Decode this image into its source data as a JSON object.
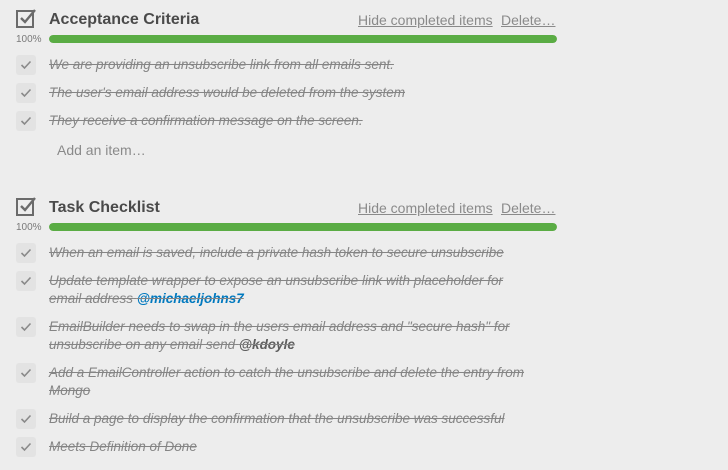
{
  "checklists": [
    {
      "title": "Acceptance Criteria",
      "hide_completed_label": "Hide completed items",
      "delete_label": "Delete…",
      "progress_label": "100%",
      "progress": 1.0,
      "progress_color": "#5aac44",
      "items": [
        {
          "text": "We are providing an unsubscribe link from all emails sent.",
          "checked": true
        },
        {
          "text": "The user's email address would be deleted from the system",
          "checked": true
        },
        {
          "text": "They receive a confirmation message on the screen.",
          "checked": true
        }
      ],
      "add_item_label": "Add an item…"
    },
    {
      "title": "Task Checklist",
      "hide_completed_label": "Hide completed items",
      "delete_label": "Delete…",
      "progress_label": "100%",
      "progress": 1.0,
      "progress_color": "#5aac44",
      "items": [
        {
          "text": "When an email is saved, include a private hash token to secure unsubscribe",
          "checked": true
        },
        {
          "text": "Update template wrapper to expose an unsubscribe link with placeholder for email address",
          "mention": "@michaeljohns7",
          "mention_linked": true,
          "checked": true
        },
        {
          "text": "EmailBuilder needs to swap in the users email address and \"secure hash\" for unsubscribe on any email send",
          "mention": "@kdoyle",
          "mention_linked": false,
          "checked": true
        },
        {
          "text": "Add a EmailController action to catch the unsubscribe and delete the entry from Mongo",
          "checked": true
        },
        {
          "text": "Build a page to display the confirmation that the unsubscribe was successful",
          "checked": true
        },
        {
          "text": "Meets Definition of Done",
          "checked": true
        }
      ]
    }
  ]
}
